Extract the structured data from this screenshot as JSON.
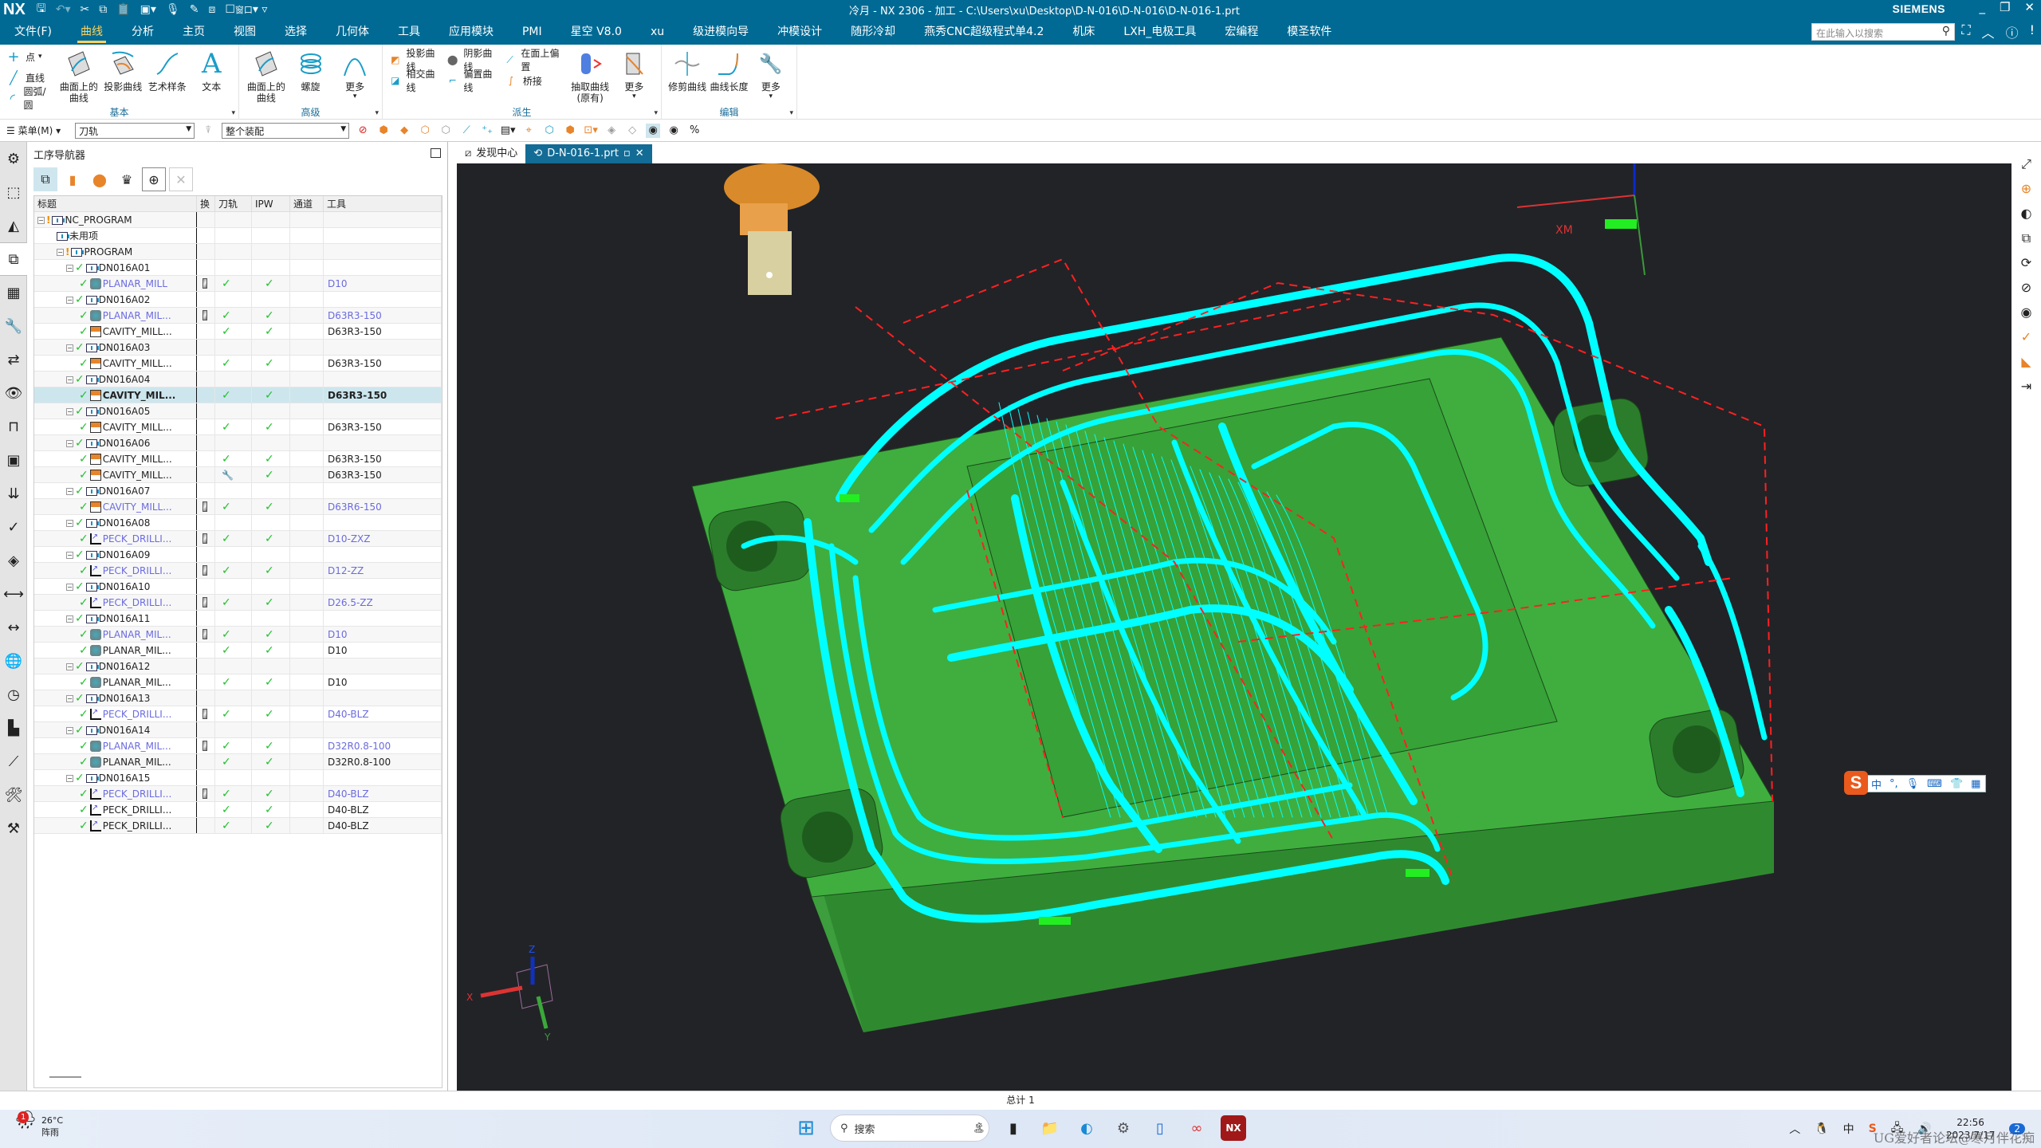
{
  "app": {
    "logo": "NX",
    "title": "冷月 - NX 2306 - 加工 - C:\\Users\\xu\\Desktop\\D-N-016\\D-N-016\\D-N-016-1.prt",
    "brand": "SIEMENS",
    "window_label": "窗口",
    "accent_color": "#006a94"
  },
  "menu": {
    "items": [
      "文件(F)",
      "曲线",
      "分析",
      "主页",
      "视图",
      "选择",
      "几何体",
      "工具",
      "应用模块",
      "PMI",
      "星空 V8.0",
      "xu",
      "级进模向导",
      "冲模设计",
      "随形冷却",
      "燕秀CNC超级程式单4.2",
      "机床",
      "LXH_电极工具",
      "宏编程",
      "模圣软件"
    ],
    "active": "曲线",
    "search_placeholder": "在此输入以搜索"
  },
  "ribbon": {
    "groups": [
      {
        "label": "基本",
        "small": [
          "点",
          "直线",
          "圆弧/圆"
        ],
        "big": [
          "曲面上的曲线",
          "投影曲线",
          "艺术样条",
          "文本"
        ]
      },
      {
        "label": "高级",
        "big": [
          "曲面上的曲线",
          "螺旋",
          "更多"
        ]
      },
      {
        "label": "派生",
        "small_top": [
          "投影曲线",
          "阴影曲线",
          "在面上偏置"
        ],
        "small_bottom": [
          "相交曲线",
          "偏置曲线",
          "桥接"
        ],
        "big": [
          "抽取曲线\n(原有)",
          "更多"
        ]
      },
      {
        "label": "编辑",
        "big": [
          "修剪曲线",
          "曲线长度",
          "更多"
        ]
      }
    ]
  },
  "filterbar": {
    "menu_label": "菜单(M)",
    "type_filter": "刀轨",
    "scope_filter": "整个装配"
  },
  "navigator": {
    "title": "工序导航器",
    "columns": [
      "标题",
      "换",
      "刀轨",
      "IPW",
      "通道",
      "工具"
    ],
    "rows": [
      {
        "level": 0,
        "kind": "root",
        "name": "NC_PROGRAM",
        "status": "excl"
      },
      {
        "level": 1,
        "kind": "folder",
        "name": "未用项",
        "status": "none"
      },
      {
        "level": 1,
        "kind": "root",
        "name": "PROGRAM",
        "status": "excl"
      },
      {
        "level": 2,
        "kind": "folder",
        "name": "DN016A01",
        "status": "ok"
      },
      {
        "level": 3,
        "kind": "planar",
        "name": "PLANAR_MILL",
        "change": true,
        "path": "ok",
        "ipw": "ok",
        "tool": "D10",
        "blue": true
      },
      {
        "level": 2,
        "kind": "folder",
        "name": "DN016A02",
        "status": "ok"
      },
      {
        "level": 3,
        "kind": "planar",
        "name": "PLANAR_MIL...",
        "change": true,
        "path": "ok",
        "ipw": "ok",
        "tool": "D63R3-150",
        "blue": true
      },
      {
        "level": 3,
        "kind": "cavity",
        "name": "CAVITY_MILL...",
        "path": "ok",
        "ipw": "ok",
        "tool": "D63R3-150"
      },
      {
        "level": 2,
        "kind": "folder",
        "name": "DN016A03",
        "status": "ok"
      },
      {
        "level": 3,
        "kind": "cavity",
        "name": "CAVITY_MILL...",
        "path": "ok",
        "ipw": "ok",
        "tool": "D63R3-150"
      },
      {
        "level": 2,
        "kind": "folder",
        "name": "DN016A04",
        "status": "ok"
      },
      {
        "level": 3,
        "kind": "cavity",
        "name": "CAVITY_MIL...",
        "path": "ok",
        "ipw": "ok",
        "tool": "D63R3-150",
        "selected": true
      },
      {
        "level": 2,
        "kind": "folder",
        "name": "DN016A05",
        "status": "ok"
      },
      {
        "level": 3,
        "kind": "cavity",
        "name": "CAVITY_MILL...",
        "path": "ok",
        "ipw": "ok",
        "tool": "D63R3-150"
      },
      {
        "level": 2,
        "kind": "folder",
        "name": "DN016A06",
        "status": "ok"
      },
      {
        "level": 3,
        "kind": "cavity",
        "name": "CAVITY_MILL...",
        "path": "ok",
        "ipw": "ok",
        "tool": "D63R3-150"
      },
      {
        "level": 3,
        "kind": "cavity",
        "name": "CAVITY_MILL...",
        "path": "wrench",
        "ipw": "ok",
        "tool": "D63R3-150"
      },
      {
        "level": 2,
        "kind": "folder",
        "name": "DN016A07",
        "status": "ok"
      },
      {
        "level": 3,
        "kind": "cavity",
        "name": "CAVITY_MILL...",
        "change": true,
        "path": "ok",
        "ipw": "ok",
        "tool": "D63R6-150",
        "blue": true
      },
      {
        "level": 2,
        "kind": "folder",
        "name": "DN016A08",
        "status": "ok"
      },
      {
        "level": 3,
        "kind": "drill",
        "name": "PECK_DRILLI...",
        "change": true,
        "path": "ok",
        "ipw": "ok",
        "tool": "D10-ZXZ",
        "blue": true
      },
      {
        "level": 2,
        "kind": "folder",
        "name": "DN016A09",
        "status": "ok"
      },
      {
        "level": 3,
        "kind": "drill",
        "name": "PECK_DRILLI...",
        "change": true,
        "path": "ok",
        "ipw": "ok",
        "tool": "D12-ZZ",
        "blue": true
      },
      {
        "level": 2,
        "kind": "folder",
        "name": "DN016A10",
        "status": "ok"
      },
      {
        "level": 3,
        "kind": "drill",
        "name": "PECK_DRILLI...",
        "change": true,
        "path": "ok",
        "ipw": "ok",
        "tool": "D26.5-ZZ",
        "blue": true
      },
      {
        "level": 2,
        "kind": "folder",
        "name": "DN016A11",
        "status": "ok"
      },
      {
        "level": 3,
        "kind": "planar",
        "name": "PLANAR_MIL...",
        "change": true,
        "path": "ok",
        "ipw": "ok",
        "tool": "D10",
        "blue": true
      },
      {
        "level": 3,
        "kind": "planar",
        "name": "PLANAR_MIL...",
        "path": "ok",
        "ipw": "ok",
        "tool": "D10"
      },
      {
        "level": 2,
        "kind": "folder",
        "name": "DN016A12",
        "status": "ok"
      },
      {
        "level": 3,
        "kind": "planar",
        "name": "PLANAR_MIL...",
        "path": "ok",
        "ipw": "ok",
        "tool": "D10"
      },
      {
        "level": 2,
        "kind": "folder",
        "name": "DN016A13",
        "status": "ok"
      },
      {
        "level": 3,
        "kind": "drill",
        "name": "PECK_DRILLI...",
        "change": true,
        "path": "ok",
        "ipw": "ok",
        "tool": "D40-BLZ",
        "blue": true
      },
      {
        "level": 2,
        "kind": "folder",
        "name": "DN016A14",
        "status": "ok"
      },
      {
        "level": 3,
        "kind": "planar",
        "name": "PLANAR_MIL...",
        "change": true,
        "path": "ok",
        "ipw": "ok",
        "tool": "D32R0.8-100",
        "blue": true
      },
      {
        "level": 3,
        "kind": "planar",
        "name": "PLANAR_MIL...",
        "path": "ok",
        "ipw": "ok",
        "tool": "D32R0.8-100"
      },
      {
        "level": 2,
        "kind": "folder",
        "name": "DN016A15",
        "status": "ok"
      },
      {
        "level": 3,
        "kind": "drill",
        "name": "PECK_DRILLI...",
        "change": true,
        "path": "ok",
        "ipw": "ok",
        "tool": "D40-BLZ",
        "blue": true
      },
      {
        "level": 3,
        "kind": "drill",
        "name": "PECK_DRILLI...",
        "path": "ok",
        "ipw": "ok",
        "tool": "D40-BLZ"
      },
      {
        "level": 3,
        "kind": "drill",
        "name": "PECK_DRILLI...",
        "path": "ok",
        "ipw": "ok",
        "tool": "D40-BLZ"
      }
    ]
  },
  "tabs": [
    {
      "label": "发现中心",
      "active": false
    },
    {
      "label": "D-N-016-1.prt",
      "active": true
    }
  ],
  "viewport": {
    "triad": {
      "x": "X",
      "y": "Y",
      "z": "Z"
    },
    "mcs_label": "XM",
    "colors": {
      "background": "#222327",
      "part": "#3aa83a",
      "toolpath": "#00ffff",
      "non_cutting": "#ff2020"
    }
  },
  "status": {
    "text": "总计 1"
  },
  "ime": {
    "items": [
      "中",
      "°,",
      "mic",
      "keyboard",
      "skin",
      "apps"
    ]
  },
  "taskbar": {
    "weather_temp": "26°C",
    "weather_desc": "阵雨",
    "weather_badge": "1",
    "search_label": "搜索",
    "time": "22:56",
    "date": "2023/7/17",
    "ime_lang": "中",
    "notification_count": "2"
  },
  "watermark": "UG爱好者论坛@寒月伴花痴"
}
